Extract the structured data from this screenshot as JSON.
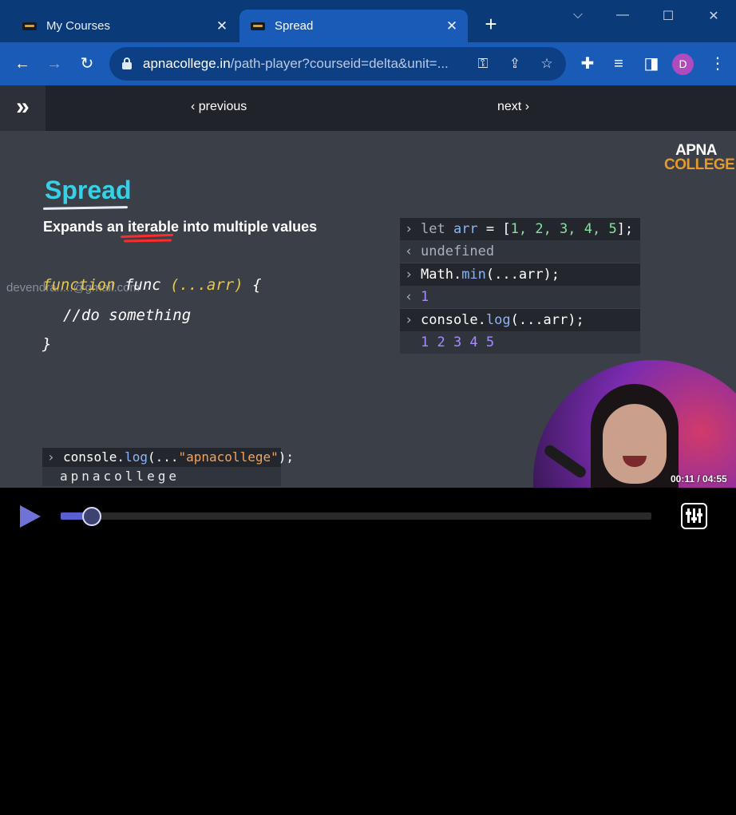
{
  "browser": {
    "tabs": [
      {
        "title": "My Courses",
        "active": false
      },
      {
        "title": "Spread",
        "active": true
      }
    ],
    "url_domain": "apnacollege.in",
    "url_path": "/path-player?courseid=delta&unit=...",
    "avatar_letter": "D",
    "accent": "#1a5bb8"
  },
  "page_nav": {
    "previous_label": "previous",
    "next_label": "next"
  },
  "slide": {
    "logo_line1": "APNA",
    "logo_line2": "COLLEGE",
    "title": "Spread",
    "subtitle_pre": "Expands an ",
    "subtitle_mark": "iterable",
    "subtitle_post": " into multiple values",
    "watermark": "devendra.....@gmail.com",
    "code_kw": "function",
    "code_fn": " func ",
    "code_arg": "(...arr)",
    "code_brace": " {",
    "code_body": "//do something",
    "code_end": "}",
    "console": {
      "r1_kw": "let ",
      "r1_var": "arr",
      "r1_eq": " = [",
      "r1_nums": "1, 2, 3, 4, 5",
      "r1_end": "];",
      "r2": "undefined",
      "r3_obj": "Math.",
      "r3_fn": "min",
      "r3_args": "(...arr);",
      "r4": "1",
      "r5_obj": "console.",
      "r5_fn": "log",
      "r5_args": "(...arr);",
      "r6": "1 2 3 4 5"
    },
    "console2": {
      "in_obj": "console.",
      "in_fn": "log",
      "in_open": "(...",
      "in_str": "\"apnacollege\"",
      "in_close": ");",
      "out": "apnacollege"
    }
  },
  "player": {
    "time_current": "00:11",
    "time_total": "04:55",
    "timecode": "00:11 / 04:55",
    "progress_fraction": 0.037,
    "play_color": "#6f73d8"
  }
}
